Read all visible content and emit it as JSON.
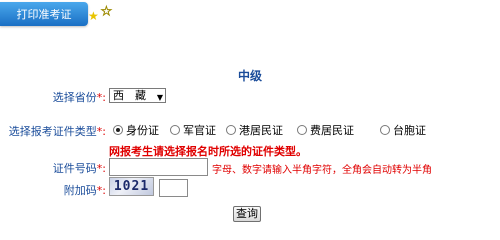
{
  "tab": {
    "label": "打印准考证"
  },
  "form": {
    "heading": "中级",
    "province": {
      "label": "选择省份",
      "required_mark": "*:",
      "value": "西　藏"
    },
    "id_type": {
      "label": "选择报考证件类型",
      "required_mark": "*:",
      "options": [
        {
          "label": "身份证",
          "selected": true
        },
        {
          "label": "军官证",
          "selected": false
        },
        {
          "label": "港居民证",
          "selected": false
        },
        {
          "label": "费居民证",
          "selected": false
        },
        {
          "label": "台胞证",
          "selected": false
        }
      ],
      "warning": "网报考生请选择报名时所选的证件类型。"
    },
    "id_number": {
      "label": "证件号码",
      "required_mark": "*:",
      "value": "",
      "hint": "字母、数字请输入半角字符，全角会自动转为半角"
    },
    "captcha": {
      "label": "附加码",
      "required_mark": "*:",
      "image_text": "1021",
      "value": ""
    },
    "submit_label": "查询"
  },
  "colors": {
    "label": "#1a4c9a",
    "warning": "#e00000",
    "tab": "#2a84d8"
  }
}
